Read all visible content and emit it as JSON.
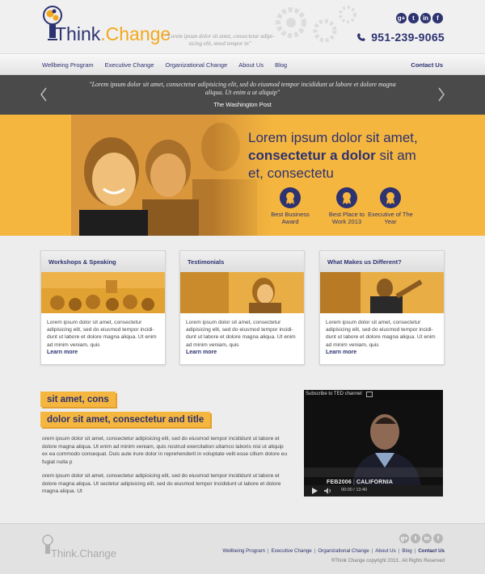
{
  "brand": {
    "think": "Think",
    "dot": ".",
    "change": "Change",
    "tagline": "\"Lorem ipsum dolor sit amet, consectetur adipi-sicing elit, smod tempor in\""
  },
  "header": {
    "social": [
      {
        "icon": "google-plus-icon",
        "glyph": "g+"
      },
      {
        "icon": "tumblr-icon",
        "glyph": "t"
      },
      {
        "icon": "linkedin-icon",
        "glyph": "in"
      },
      {
        "icon": "facebook-icon",
        "glyph": "f"
      }
    ],
    "phone": "951-239-9065"
  },
  "nav": {
    "items": [
      "Wellbeing Program",
      "Executive Change",
      "Organizational Change",
      "About Us",
      "Blog"
    ],
    "contact": "Contact Us"
  },
  "quote": {
    "text": "\"Lorem ipsum dolor sit amet, consectetur adipisicing elit, sed do eiusmod tempor incididunt ut labore et dolore magna aliqua. Ut enim a ut aliquip\"",
    "source": "The Washington Post"
  },
  "hero": {
    "line1": "Lorem ipsum dolor sit amet,",
    "line2_bold": "consectetur a dolor",
    "line2_rest": " sit am",
    "line3": "et, consectetu",
    "awards": [
      "Best Business Award",
      "Best Place to Work 2013",
      "Executive of The Year"
    ]
  },
  "cards": [
    {
      "title": "Workshops & Speaking",
      "text": "Lorem ipsum dolor sit amet, consectetur adipisicing elit, sed do eiusmod tempor incidi-dunt ut labore et dolore magna aliqua. Ut enim ad minim veniam, quis",
      "more": "Learn more"
    },
    {
      "title": "Testimonials",
      "text": "Lorem ipsum dolor sit amet, consectetur adipisicing elit, sed do eiusmod tempor incidi-dunt ut labore et dolore magna aliqua. Ut enim ad minim veniam, quis",
      "more": "Learn more"
    },
    {
      "title": "What Makes us Different?",
      "text": "Lorem ipsum dolor sit amet, consectetur adipisicing elit, sed do eiusmod tempor incidi-dunt ut labore et dolore magna aliqua. Ut enim ad minim veniam, quis",
      "more": "Learn more"
    }
  ],
  "content": {
    "tag1": "sit amet, cons",
    "tag2": "dolor sit amet, consectetur and title",
    "para1": "orem ipsum dolor sit amet, consectetur adipisicing elit, sed do eiusmod tempor incididunt ut labore et dolore magna aliqua. Ut enim ad minim veniam, quis nostrud exercitation ullamco laboris nisi ut aliquip ex ea commodo consequat. Duis aute irure dolor in reprehenderit in voluptate velit esse cillum dolore eu fugiat nulla p",
    "para2": "orem ipsum dolor sit amet, consectetur adipisicing elit, sed do eiusmod tempor incididunt ut labore et dolore magna aliqua. Ut sectetur adipisicing elit, sed do eiusmod tempor incididunt ut labore et dolore magna aliqua. Ut"
  },
  "video": {
    "subscribe": "Subscribe to TED channel",
    "caption_year": "FEB2006",
    "caption_place": "CALIFORNIA",
    "caption_sep": "|",
    "time": "00:00 / 13:40"
  },
  "footer": {
    "logo": "Think.Change",
    "links": [
      "Wellbeing Program",
      "Executive Change",
      "Organizational Change",
      "About Us",
      "Blog"
    ],
    "contact": "Contact Us",
    "copyright": "®Think Change copyright 2013.. All Rights Reserved"
  },
  "colors": {
    "navy": "#2d3270",
    "gold": "#f5b63f",
    "dark_strip": "#4a4a4a"
  }
}
